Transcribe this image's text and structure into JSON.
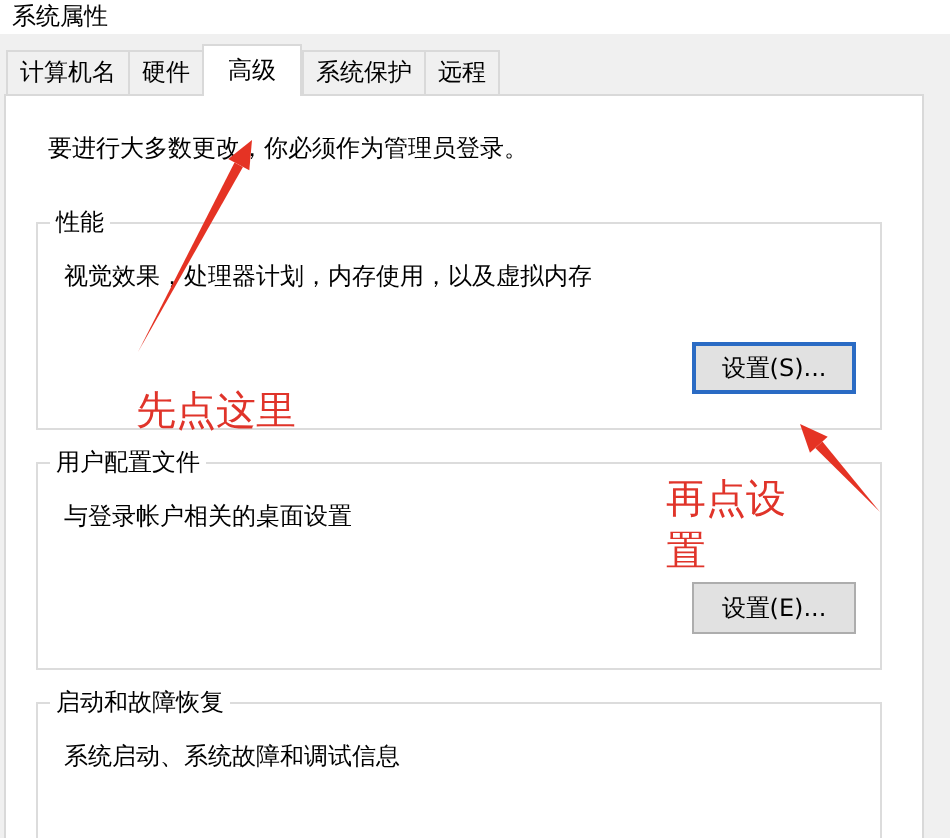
{
  "window": {
    "title": "系统属性"
  },
  "tabs": [
    {
      "label": "计算机名",
      "selected": false
    },
    {
      "label": "硬件",
      "selected": false
    },
    {
      "label": "高级",
      "selected": true
    },
    {
      "label": "系统保护",
      "selected": false
    },
    {
      "label": "远程",
      "selected": false
    }
  ],
  "notice": "要进行大多数更改，你必须作为管理员登录。",
  "groups": [
    {
      "title": "性能",
      "description": "视觉效果，处理器计划，内存使用，以及虚拟内存",
      "button": {
        "label": "设置(S)...",
        "focused": true
      }
    },
    {
      "title": "用户配置文件",
      "description": "与登录帐户相关的桌面设置",
      "button": {
        "label": "设置(E)...",
        "focused": false
      }
    },
    {
      "title": "启动和故障恢复",
      "description": "系统启动、系统故障和调试信息"
    }
  ],
  "annotations": [
    {
      "text": "先点这里"
    },
    {
      "text": "再点设置"
    }
  ]
}
